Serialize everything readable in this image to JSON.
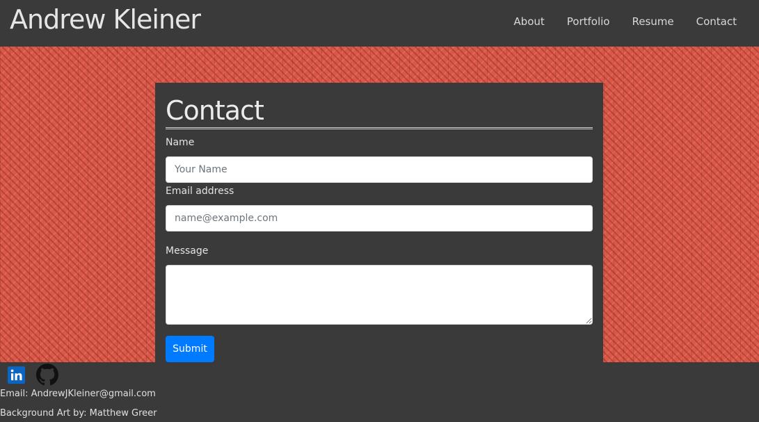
{
  "nav": {
    "brand": "Andrew Kleiner",
    "links": [
      "About",
      "Portfolio",
      "Resume",
      "Contact"
    ]
  },
  "contact": {
    "title": "Contact",
    "name_label": "Name",
    "name_placeholder": "Your Name",
    "email_label": "Email address",
    "email_placeholder": "name@example.com",
    "message_label": "Message",
    "submit_label": "Submit"
  },
  "footer": {
    "social_icons": [
      "linkedin-icon",
      "github-icon"
    ],
    "email": "Email: AndrewJKleiner@gmail.com",
    "credit": "Background Art by: Matthew Greer"
  },
  "colors": {
    "background": "#3a3a3a",
    "hero": "#d9584a",
    "accent": "#007bff",
    "linkedin": "#0a66c2"
  }
}
